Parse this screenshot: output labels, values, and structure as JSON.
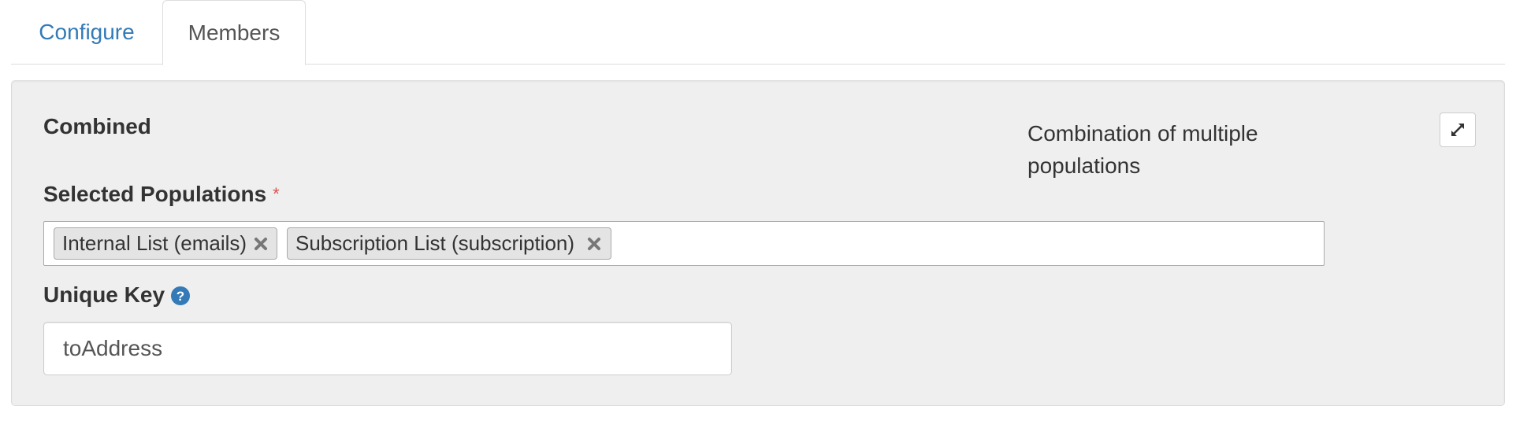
{
  "tabs": [
    {
      "label": "Configure",
      "active": false
    },
    {
      "label": "Members",
      "active": true
    }
  ],
  "panel": {
    "title": "Combined",
    "description": "Combination of multiple populations",
    "expand_icon": "expand-icon"
  },
  "populations": {
    "label": "Selected Populations",
    "required_mark": "*",
    "tags": [
      {
        "label": "Internal List (emails)"
      },
      {
        "label": "Subscription List (subscription)"
      }
    ]
  },
  "unique_key": {
    "label": "Unique Key",
    "help_icon": "question-circle-icon",
    "value": "toAddress"
  },
  "colors": {
    "link": "#337ab7",
    "required": "#d9534f",
    "panel_bg": "#efefef"
  }
}
